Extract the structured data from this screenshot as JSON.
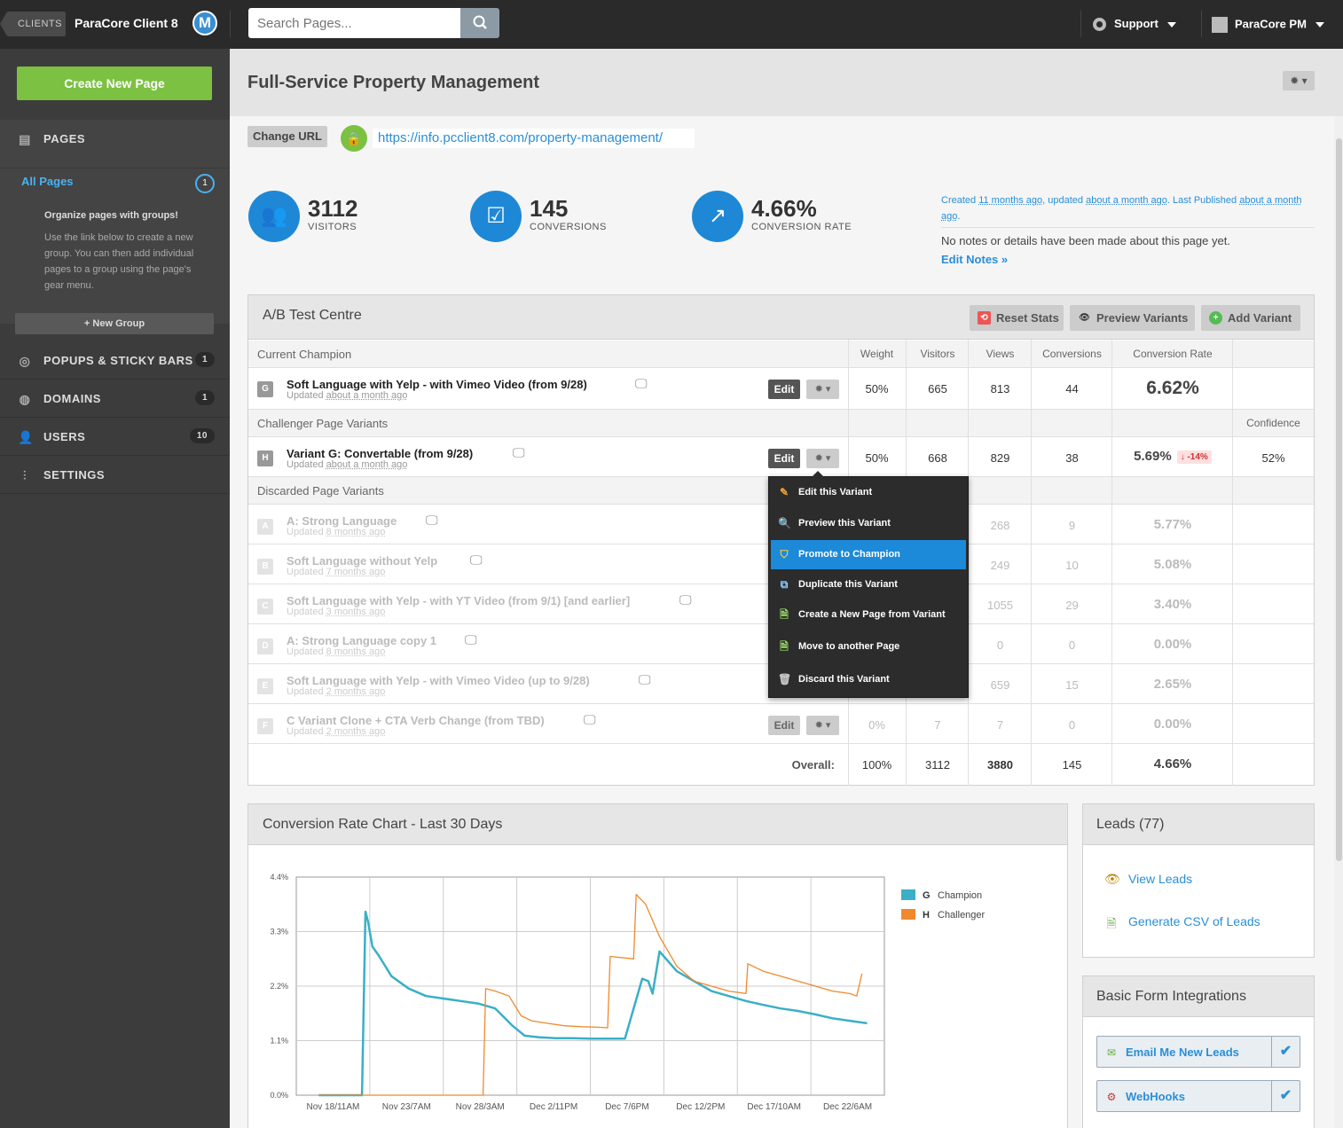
{
  "topbar": {
    "clients_label": "CLIENTS",
    "client_name": "ParaCore Client 8",
    "logo_letter": "M",
    "search_placeholder": "Search Pages...",
    "support_label": "Support",
    "user_label": "ParaCore PM"
  },
  "sidebar": {
    "create_label": "Create New Page",
    "pages_label": "PAGES",
    "all_pages_label": "All Pages",
    "all_pages_count": "1",
    "org_title": "Organize pages with groups!",
    "org_text": "Use the link below to create a new group. You can then add individual pages to a group using the page's gear menu.",
    "new_group_label": "+ New Group",
    "items": [
      {
        "label": "POPUPS & STICKY BARS",
        "count": "1",
        "icon": "target-icon"
      },
      {
        "label": "DOMAINS",
        "count": "1",
        "icon": "globe-icon"
      },
      {
        "label": "USERS",
        "count": "10",
        "icon": "users-icon"
      },
      {
        "label": "SETTINGS",
        "count": "",
        "icon": "sliders-icon"
      }
    ]
  },
  "page": {
    "title": "Full-Service Property Management",
    "change_url_label": "Change URL",
    "url": "https://info.pcclient8.com/property-management/"
  },
  "stats": {
    "visitors": "3112",
    "visitors_label": "VISITORS",
    "conversions": "145",
    "conversions_label": "CONVERSIONS",
    "rate": "4.66%",
    "rate_label": "CONVERSION RATE"
  },
  "meta": {
    "created_prefix": "Created ",
    "created_ago": "11 months ago",
    "updated_prefix": ", updated ",
    "updated_ago": "about a month ago",
    "published_prefix": ". Last Published ",
    "published_ago": "about a month ago",
    "published_suffix": ".",
    "no_notes": "No notes or details have been made about this page yet.",
    "edit_notes": "Edit Notes »"
  },
  "ab": {
    "title": "A/B Test Centre",
    "reset_label": "Reset Stats",
    "preview_label": "Preview Variants",
    "add_label": "Add Variant",
    "champion_section": "Current Champion",
    "challenger_section": "Challenger Page Variants",
    "discarded_section": "Discarded Page Variants",
    "columns": [
      "Weight",
      "Visitors",
      "Views",
      "Conversions",
      "Conversion Rate"
    ],
    "confidence_label": "Confidence",
    "edit_label": "Edit",
    "updated_label": "Updated ",
    "overall_label": "Overall:",
    "champion": {
      "letter": "G",
      "name": "Soft Language with Yelp - with Vimeo Video (from 9/28)",
      "updated": "about a month ago",
      "weight": "50%",
      "visitors": "665",
      "views": "813",
      "conversions": "44",
      "rate": "6.62%"
    },
    "challenger": {
      "letter": "H",
      "name": "Variant G: Convertable (from 9/28)",
      "updated": "about a month ago",
      "weight": "50%",
      "visitors": "668",
      "views": "829",
      "conversions": "38",
      "rate": "5.69%",
      "delta": "↓ -14%",
      "confidence": "52%"
    },
    "discarded": [
      {
        "letter": "A",
        "name": "A: Strong Language",
        "updated": "8 months ago",
        "views": "268",
        "conversions": "9",
        "rate": "5.77%"
      },
      {
        "letter": "B",
        "name": "Soft Language without Yelp",
        "updated": "7 months ago",
        "views": "249",
        "conversions": "10",
        "rate": "5.08%"
      },
      {
        "letter": "C",
        "name": "Soft Language with Yelp - with YT Video (from 9/1) [and earlier]",
        "updated": "3 months ago",
        "views": "1055",
        "conversions": "29",
        "rate": "3.40%"
      },
      {
        "letter": "D",
        "name": "A: Strong Language copy 1",
        "updated": "8 months ago",
        "views": "0",
        "conversions": "0",
        "rate": "0.00%"
      },
      {
        "letter": "E",
        "name": "Soft Language with Yelp - with Vimeo Video (up to 9/28)",
        "updated": "2 months ago",
        "views": "659",
        "conversions": "15",
        "rate": "2.65%"
      },
      {
        "letter": "F",
        "name": "C Variant Clone + CTA Verb Change (from TBD)",
        "updated": "2 months ago",
        "weight": "0%",
        "visitors": "7",
        "views": "7",
        "conversions": "0",
        "rate": "0.00%"
      }
    ],
    "overall": {
      "weight": "100%",
      "visitors": "3112",
      "views": "3880",
      "conversions": "145",
      "rate": "4.66%"
    }
  },
  "menu": {
    "items": [
      {
        "label": "Edit this Variant",
        "icon": "pencil-icon"
      },
      {
        "label": "Preview this Variant",
        "icon": "magnifier-icon"
      },
      {
        "label": "Promote to Champion",
        "icon": "shield-icon"
      },
      {
        "label": "Duplicate this Variant",
        "icon": "duplicate-icon"
      },
      {
        "label": "Create a New Page from Variant",
        "icon": "new-page-icon"
      },
      {
        "label": "Move to another Page",
        "icon": "move-page-icon"
      },
      {
        "label": "Discard this Variant",
        "icon": "trash-icon"
      }
    ],
    "active_index": 2
  },
  "chart_title": "Conversion Rate Chart - Last 30 Days",
  "chart_data": {
    "type": "line",
    "title": "",
    "ylim": [
      0,
      4.4
    ],
    "y_ticks": [
      "0.0%",
      "1.1%",
      "2.2%",
      "3.3%",
      "4.4%"
    ],
    "x_ticks": [
      "Nov 18/11AM",
      "Nov 23/7AM",
      "Nov 28/3AM",
      "Dec 2/11PM",
      "Dec 7/6PM",
      "Dec 12/2PM",
      "Dec 17/10AM",
      "Dec 22/6AM"
    ],
    "x_range": [
      0,
      34
    ],
    "grid": true,
    "legend_position": "right",
    "series": [
      {
        "name": "Champion",
        "letter": "G",
        "color": "#3aafc6",
        "x": [
          1.3,
          3.8,
          4.0,
          4.15,
          4.4,
          4.8,
          5.5,
          6.5,
          7.5,
          8.5,
          9.5,
          10.5,
          11.5,
          12.5,
          13.2,
          14.0,
          15.0,
          16.0,
          17.0,
          18.0,
          19.0,
          20.0,
          20.35,
          20.6,
          21.0,
          22.0,
          23.0,
          24.0,
          25.0,
          26.0,
          27.0,
          28.0,
          29.0,
          30.0,
          31.0,
          32.0,
          33.0
        ],
        "y": [
          0,
          0,
          3.7,
          3.5,
          3.0,
          2.8,
          2.4,
          2.15,
          2.0,
          1.95,
          1.9,
          1.85,
          1.75,
          1.4,
          1.2,
          1.17,
          1.15,
          1.15,
          1.14,
          1.14,
          1.14,
          2.35,
          2.3,
          2.05,
          2.9,
          2.5,
          2.3,
          2.1,
          2.0,
          1.9,
          1.82,
          1.75,
          1.7,
          1.63,
          1.55,
          1.5,
          1.45
        ]
      },
      {
        "name": "Challenger",
        "letter": "H",
        "color": "#f0892c",
        "x": [
          1.3,
          10.8,
          10.95,
          11.5,
          12.3,
          13.0,
          13.6,
          14.5,
          15.5,
          16.5,
          17.5,
          18.0,
          18.15,
          19.5,
          19.65,
          20.2,
          21.0,
          22.0,
          23.0,
          24.0,
          25.0,
          26.0,
          26.1,
          27.0,
          28.0,
          29.0,
          30.0,
          31.0,
          32.0,
          32.4,
          32.7
        ],
        "y": [
          0,
          0,
          2.15,
          2.1,
          2.0,
          1.6,
          1.5,
          1.45,
          1.4,
          1.38,
          1.37,
          1.36,
          2.8,
          2.75,
          4.05,
          3.85,
          3.2,
          2.6,
          2.3,
          2.2,
          2.1,
          2.05,
          2.65,
          2.5,
          2.4,
          2.3,
          2.2,
          2.1,
          2.05,
          2.0,
          2.45
        ]
      }
    ]
  },
  "leads": {
    "title": "Leads (77)",
    "view_label": "View Leads",
    "csv_label": "Generate CSV of Leads"
  },
  "forms": {
    "title": "Basic Form Integrations",
    "items": [
      {
        "label": "Email Me New Leads"
      },
      {
        "label": "WebHooks"
      }
    ]
  }
}
